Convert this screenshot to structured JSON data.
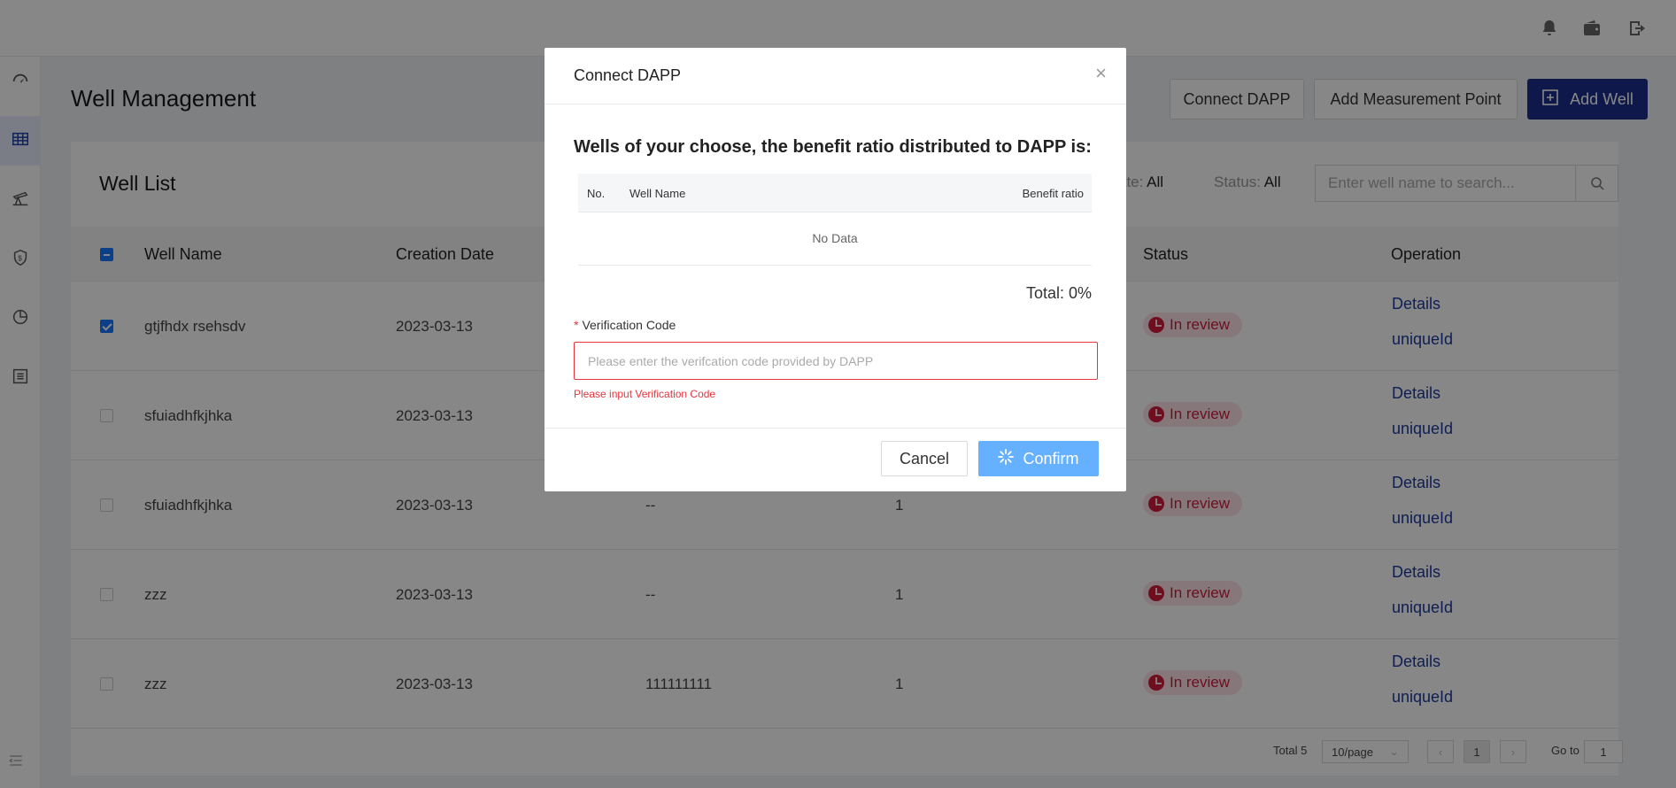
{
  "app": {
    "page_title": "Well Management",
    "header_buttons": {
      "connect_dapp": "Connect DAPP",
      "add_measurement_point": "Add Measurement Point",
      "add_well": "Add Well"
    }
  },
  "sidebar": {
    "items": [
      {
        "icon": "dashboard-icon"
      },
      {
        "icon": "table-icon",
        "active": true
      },
      {
        "icon": "oil-pump-icon"
      },
      {
        "icon": "shield-dollar-icon"
      },
      {
        "icon": "pie-chart-icon"
      },
      {
        "icon": "list-icon"
      }
    ]
  },
  "well_list": {
    "title": "Well List",
    "filter_date_label": "ate:",
    "filter_date_value": "All",
    "filter_status_label": "Status:",
    "filter_status_value": "All",
    "search_placeholder": "Enter well name to search...",
    "columns": {
      "well_name": "Well Name",
      "creation_date": "Creation Date",
      "status": "Status",
      "operation": "Operation"
    },
    "rows": [
      {
        "name": "gtjfhdx rsehsdv",
        "date": "2023-03-13",
        "col3": "",
        "col4": "",
        "status": "In review",
        "op1": "Details",
        "op2": "uniqueId",
        "checked": true
      },
      {
        "name": "sfuiadhfkjhka",
        "date": "2023-03-13",
        "col3": "",
        "col4": "",
        "status": "In review",
        "op1": "Details",
        "op2": "uniqueId",
        "checked": false
      },
      {
        "name": "sfuiadhfkjhka",
        "date": "2023-03-13",
        "col3": "--",
        "col4": "1",
        "status": "In review",
        "op1": "Details",
        "op2": "uniqueId",
        "checked": false
      },
      {
        "name": "zzz",
        "date": "2023-03-13",
        "col3": "--",
        "col4": "1",
        "status": "In review",
        "op1": "Details",
        "op2": "uniqueId",
        "checked": false
      },
      {
        "name": "zzz",
        "date": "2023-03-13",
        "col3": "111111111",
        "col4": "1",
        "status": "In review",
        "op1": "Details",
        "op2": "uniqueId",
        "checked": false
      }
    ]
  },
  "pagination": {
    "total": "Total 5",
    "page_size": "10/page",
    "current_page": "1",
    "goto_label": "Go to",
    "goto_value": "1"
  },
  "modal": {
    "title": "Connect DAPP",
    "subtitle": "Wells of your choose, the benefit ratio distributed to DAPP is:",
    "table_columns": {
      "no": "No.",
      "well_name": "Well Name",
      "benefit_ratio": "Benefit ratio"
    },
    "empty_text": "No Data",
    "total": "Total: 0%",
    "verification_label": "Verification Code",
    "required_mark": "*",
    "verification_placeholder": "Please enter the verifcation code provided by DAPP",
    "verification_error": "Please input Verification Code",
    "cancel": "Cancel",
    "confirm": "Confirm"
  }
}
